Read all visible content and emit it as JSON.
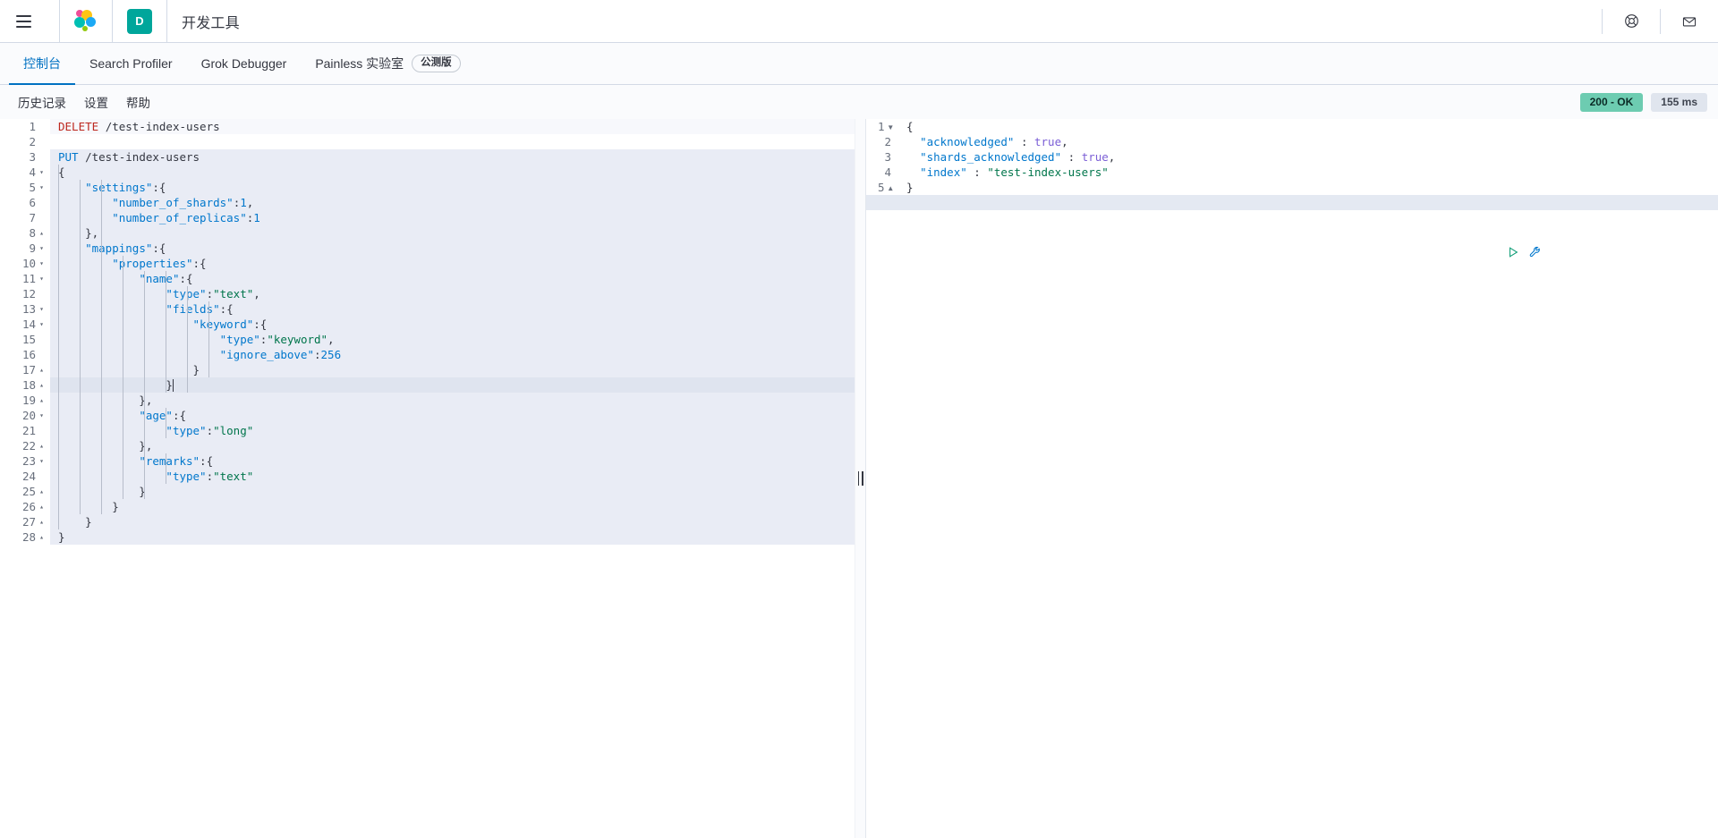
{
  "header": {
    "menu_icon": "hamburger-menu-icon",
    "logo_icon": "elastic-logo-icon",
    "app_badge_letter": "D",
    "app_title": "开发工具",
    "help_icon": "help-lifebuoy-icon",
    "mail_icon": "mail-envelope-icon"
  },
  "tabs": [
    {
      "label": "控制台",
      "active": true,
      "badge": ""
    },
    {
      "label": "Search Profiler",
      "active": false,
      "badge": ""
    },
    {
      "label": "Grok Debugger",
      "active": false,
      "badge": ""
    },
    {
      "label": "Painless 实验室",
      "active": false,
      "badge": "公测版"
    }
  ],
  "console_menu": [
    {
      "label": "历史记录"
    },
    {
      "label": "设置"
    },
    {
      "label": "帮助"
    }
  ],
  "status": {
    "code_label": "200 - OK",
    "time_label": "155 ms",
    "ok_color": "#6dccb1",
    "ms_color": "#e0e5ee"
  },
  "editor_actions": {
    "play_label": "send-request",
    "wrench_label": "request-options"
  },
  "splitter": {
    "grip_icon": "vertical-grip-icon"
  },
  "request_editor": {
    "active_line": 18,
    "lines": [
      {
        "n": 1,
        "fold": "",
        "text": "DELETE /test-index-users"
      },
      {
        "n": 2,
        "fold": "",
        "text": ""
      },
      {
        "n": 3,
        "fold": "",
        "text": "PUT /test-index-users"
      },
      {
        "n": 4,
        "fold": "▾",
        "text": "{"
      },
      {
        "n": 5,
        "fold": "▾",
        "text": "    \"settings\":{"
      },
      {
        "n": 6,
        "fold": "",
        "text": "        \"number_of_shards\":1,"
      },
      {
        "n": 7,
        "fold": "",
        "text": "        \"number_of_replicas\":1"
      },
      {
        "n": 8,
        "fold": "▴",
        "text": "    },"
      },
      {
        "n": 9,
        "fold": "▾",
        "text": "    \"mappings\":{"
      },
      {
        "n": 10,
        "fold": "▾",
        "text": "        \"properties\":{"
      },
      {
        "n": 11,
        "fold": "▾",
        "text": "            \"name\":{"
      },
      {
        "n": 12,
        "fold": "",
        "text": "                \"type\":\"text\","
      },
      {
        "n": 13,
        "fold": "▾",
        "text": "                \"fields\":{"
      },
      {
        "n": 14,
        "fold": "▾",
        "text": "                    \"keyword\":{"
      },
      {
        "n": 15,
        "fold": "",
        "text": "                        \"type\":\"keyword\","
      },
      {
        "n": 16,
        "fold": "",
        "text": "                        \"ignore_above\":256"
      },
      {
        "n": 17,
        "fold": "▴",
        "text": "                    }"
      },
      {
        "n": 18,
        "fold": "▴",
        "text": "                }"
      },
      {
        "n": 19,
        "fold": "▴",
        "text": "            },"
      },
      {
        "n": 20,
        "fold": "▾",
        "text": "            \"age\":{"
      },
      {
        "n": 21,
        "fold": "",
        "text": "                \"type\":\"long\""
      },
      {
        "n": 22,
        "fold": "▴",
        "text": "            },"
      },
      {
        "n": 23,
        "fold": "▾",
        "text": "            \"remarks\":{"
      },
      {
        "n": 24,
        "fold": "",
        "text": "                \"type\":\"text\""
      },
      {
        "n": 25,
        "fold": "▴",
        "text": "            }"
      },
      {
        "n": 26,
        "fold": "▴",
        "text": "        }"
      },
      {
        "n": 27,
        "fold": "▴",
        "text": "    }"
      },
      {
        "n": 28,
        "fold": "▴",
        "text": "}"
      }
    ]
  },
  "response_editor": {
    "active_line": 6,
    "lines": [
      {
        "n": 1,
        "fold": "▾",
        "text": "{"
      },
      {
        "n": 2,
        "fold": "",
        "text": "  \"acknowledged\" : true,"
      },
      {
        "n": 3,
        "fold": "",
        "text": "  \"shards_acknowledged\" : true,"
      },
      {
        "n": 4,
        "fold": "",
        "text": "  \"index\" : \"test-index-users\""
      },
      {
        "n": 5,
        "fold": "▴",
        "text": "}"
      },
      {
        "n": 6,
        "fold": "",
        "text": ""
      }
    ]
  }
}
